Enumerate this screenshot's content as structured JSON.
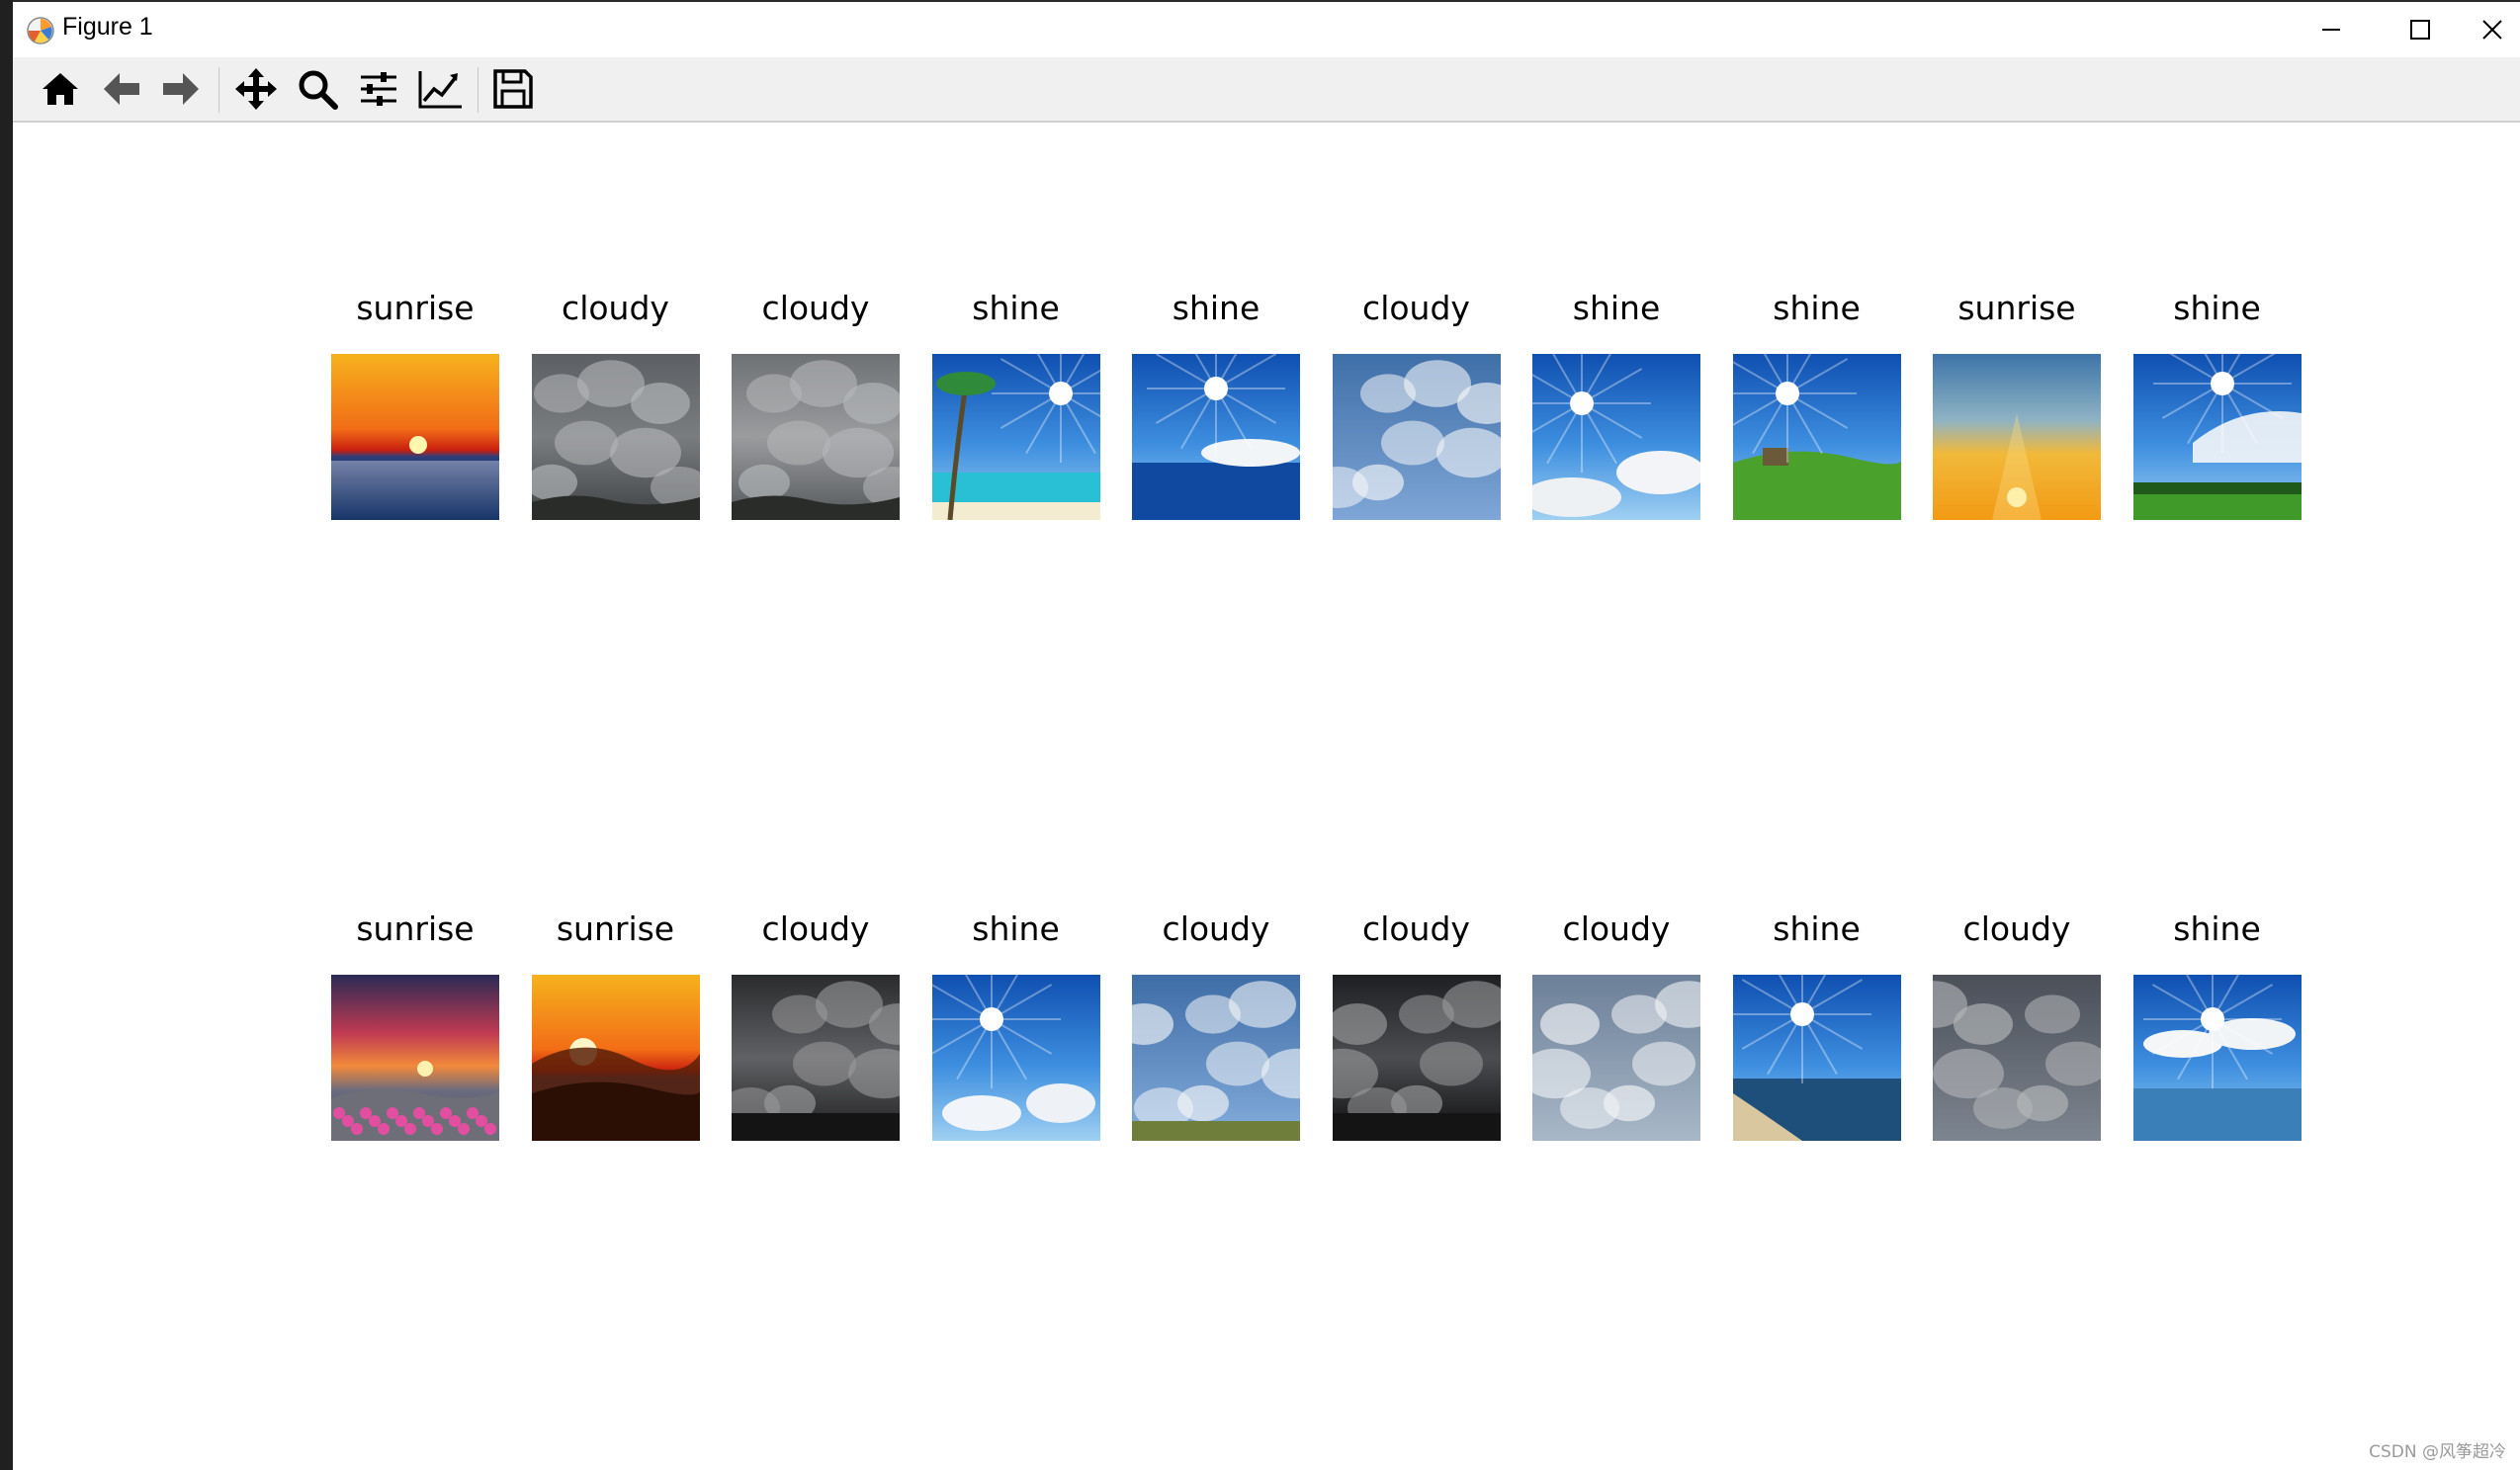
{
  "window": {
    "title": "Figure 1",
    "controls": [
      "minimize-icon",
      "maximize-icon",
      "close-icon"
    ]
  },
  "toolbar": {
    "tools": [
      {
        "name": "home",
        "icon": "home-icon"
      },
      {
        "name": "back",
        "icon": "arrow-left-icon"
      },
      {
        "name": "forward",
        "icon": "arrow-right-icon"
      },
      {
        "name": "pan",
        "icon": "move-icon"
      },
      {
        "name": "zoom",
        "icon": "magnifier-icon"
      },
      {
        "name": "configure-subplots",
        "icon": "sliders-icon"
      },
      {
        "name": "edit-axis",
        "icon": "line-chart-icon"
      },
      {
        "name": "save",
        "icon": "floppy-disk-icon"
      }
    ]
  },
  "figure": {
    "rows": [
      {
        "labels": [
          "sunrise",
          "cloudy",
          "cloudy",
          "shine",
          "shine",
          "cloudy",
          "shine",
          "shine",
          "sunrise",
          "shine"
        ]
      },
      {
        "labels": [
          "sunrise",
          "sunrise",
          "cloudy",
          "shine",
          "cloudy",
          "cloudy",
          "cloudy",
          "shine",
          "cloudy",
          "shine"
        ]
      }
    ]
  },
  "watermark": "CSDN @风筝超冷"
}
